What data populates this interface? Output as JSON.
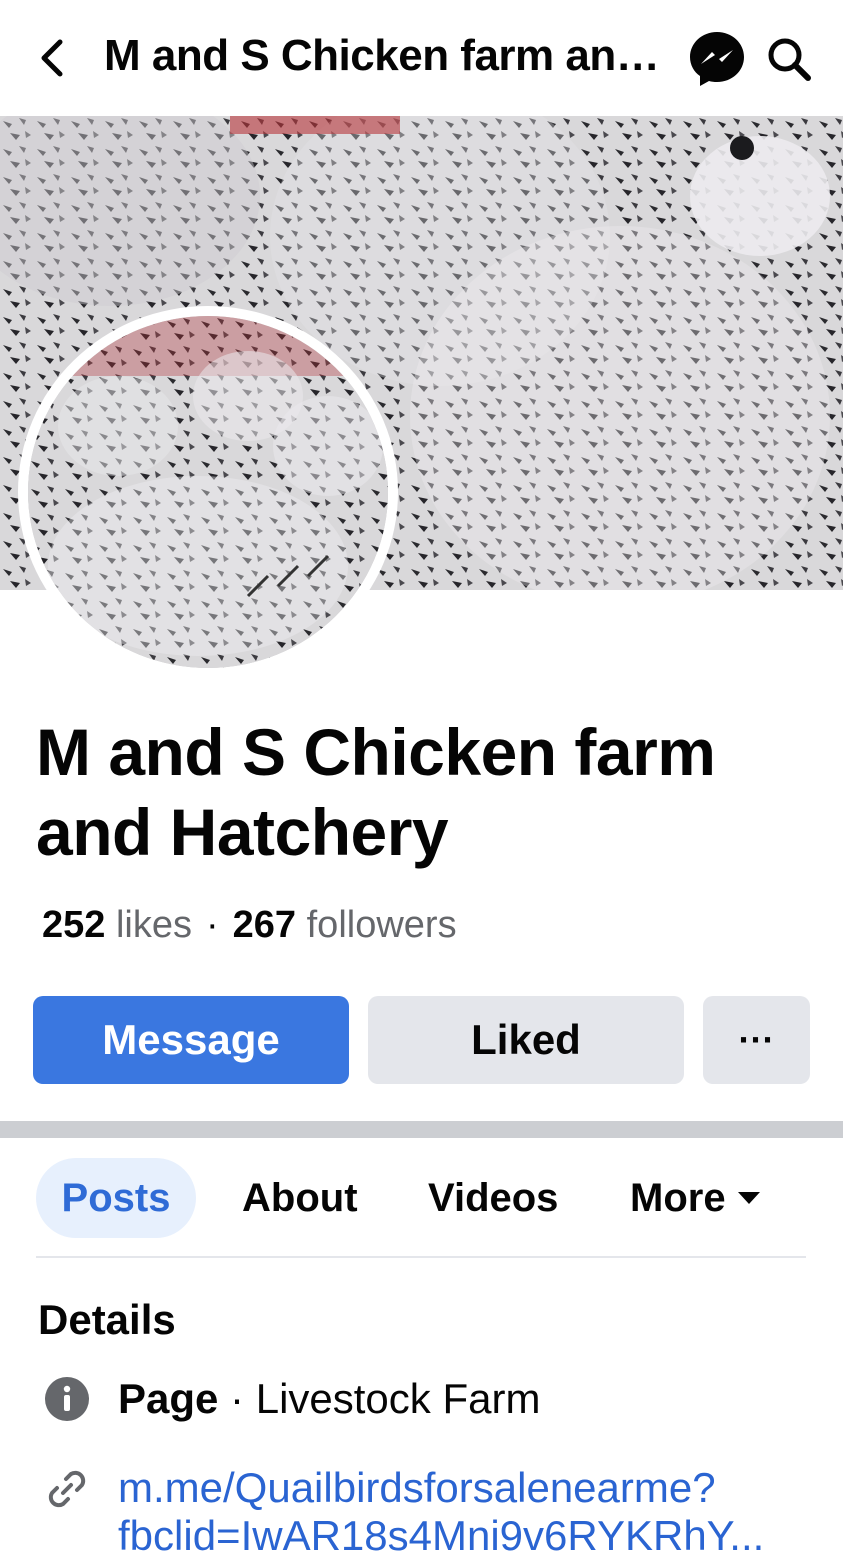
{
  "header": {
    "title": "M and  S Chicken farm and Hatchery"
  },
  "page": {
    "name": "M and  S Chicken farm and Hatchery",
    "likes_count": "252",
    "likes_label": "likes",
    "followers_count": "267",
    "followers_label": "followers",
    "separator_dot": "·"
  },
  "actions": {
    "message_label": "Message",
    "liked_label": "Liked",
    "more_label": "···"
  },
  "tabs": [
    {
      "label": "Posts",
      "active": true
    },
    {
      "label": "About"
    },
    {
      "label": "Videos"
    },
    {
      "label": "More"
    }
  ],
  "details": {
    "title": "Details",
    "category_prefix": "Page",
    "category_sep": " · ",
    "category": "Livestock Farm",
    "link_line1": "m.me/Quailbirdsforsalenearme?",
    "link_line2": "fbclid=IwAR18s4Mni9v6RYKRhY..."
  },
  "colors": {
    "primary": "#3a77e0",
    "link": "#2a64d2",
    "secondary_button": "#e4e6eb",
    "active_tab_bg": "#e7f0fd"
  },
  "icons": {
    "back": "chevron-left-icon",
    "messenger": "messenger-icon",
    "search": "search-icon",
    "info": "info-icon",
    "link": "link-icon"
  }
}
